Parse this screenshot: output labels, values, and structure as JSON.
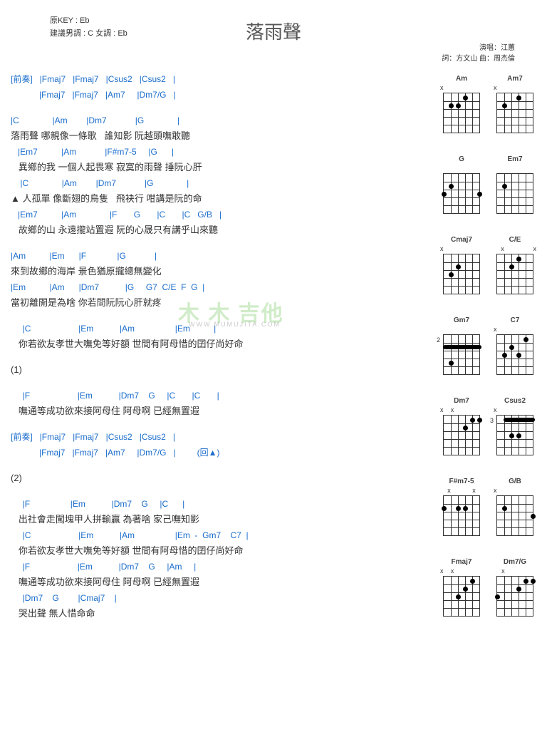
{
  "header": {
    "title": "落雨聲",
    "original_key_label": "原KEY : Eb",
    "suggested_label": "建議男調 : C 女調 : Eb",
    "singer_label": "演唱：江蕙",
    "composer_label": "詞：方文山  曲：周杰倫"
  },
  "watermark": {
    "main": "木 木 吉他",
    "sub": "WWW.MUMUJITA.COM"
  },
  "sections": [
    {
      "id": "intro1",
      "type": "intro",
      "lines": [
        {
          "chords": "[前奏]   |Fmaj7   |Fmaj7   |Csus2   |Csus2   |"
        },
        {
          "chords": "            |Fmaj7   |Fmaj7   |Am7     |Dm7/G   |"
        }
      ]
    },
    {
      "id": "v1",
      "type": "verse",
      "lines": [
        {
          "chords": "|C              |Am        |Dm7            |G              |",
          "lyric": "落雨聲 哪親像一條歌   誰知影 阮越頭嘸敢聽"
        },
        {
          "chords": "   |Em7          |Am            |F#m7-5     |G      |",
          "lyric": "   異鄉的我 一個人起畏寒 寂寞的雨聲 捶阮心肝"
        },
        {
          "chords": "    |C              |Am        |Dm7            |G              |",
          "lyric": "▲ 人孤單 像斷翅的鳥隻   飛袂行 咁講是阮的命"
        },
        {
          "chords": "   |Em7          |Am              |F       G       |C       |C   G/B   |",
          "lyric": "   故鄉的山 永遠攏站置遐 阮的心晟只有講乎山來聽"
        }
      ]
    },
    {
      "id": "ch1",
      "type": "chorus",
      "lines": [
        {
          "chords": "|Am          |Em      |F             |G            |",
          "lyric": "來到故鄉的海岸 景色猶原攏總無變化"
        },
        {
          "chords": "|Em          |Am      |Dm7           |G     G7  C/E  F  G  |",
          "lyric": "當初離開是為啥 你若問阮阮心肝就疼"
        }
      ]
    },
    {
      "id": "ch1b",
      "type": "chorus",
      "lines": [
        {
          "chords": "     |C                    |Em           |Am                 |Em          |",
          "lyric": "   你若欲友孝世大嘸免等好額 世間有阿母惜的囝仔尚好命"
        }
      ]
    },
    {
      "id": "label1",
      "type": "label",
      "lines": [
        {
          "lyric": "(1)"
        }
      ]
    },
    {
      "id": "ch1c",
      "type": "chorus",
      "lines": [
        {
          "chords": "     |F                    |Em           |Dm7    G     |C       |C       |",
          "lyric": "   嘸通等成功欲來接阿母住 阿母啊 已經無置遐"
        }
      ]
    },
    {
      "id": "intro2",
      "type": "intro",
      "lines": [
        {
          "chords": "[前奏]   |Fmaj7   |Fmaj7   |Csus2   |Csus2   |"
        },
        {
          "chords": "            |Fmaj7   |Fmaj7   |Am7     |Dm7/G   |         (回▲)"
        }
      ]
    },
    {
      "id": "label2",
      "type": "label",
      "lines": [
        {
          "lyric": "(2)"
        }
      ]
    },
    {
      "id": "v2",
      "type": "verse",
      "lines": [
        {
          "chords": "     |F                 |Em           |Dm7    G     |C      |",
          "lyric": "   出社會走闖塊甲人拼輸贏 為著啥 家己嘸知影"
        },
        {
          "chords": "     |C                    |Em           |Am                 |Em  -  Gm7    C7  |",
          "lyric": "   你若欲友孝世大嘸免等好額 世間有阿母惜的囝仔尚好命"
        },
        {
          "chords": "     |F                    |Em           |Dm7    G     |Am     |",
          "lyric": "   嘸通等成功欲來接阿母住 阿母啊 已經無置遐"
        },
        {
          "chords": "     |Dm7    G        |Cmaj7    |",
          "lyric": "   哭出聲 無人惜命命"
        }
      ]
    }
  ],
  "chord_diagrams": [
    {
      "name": "Am",
      "open": [
        "x",
        "",
        "",
        "",
        "",
        ""
      ],
      "dots": [
        {
          "s": 1,
          "f": 2
        },
        {
          "s": 2,
          "f": 2
        },
        {
          "s": 3,
          "f": 1
        }
      ]
    },
    {
      "name": "Am7",
      "open": [
        "x",
        "",
        "",
        "",
        "",
        ""
      ],
      "dots": [
        {
          "s": 1,
          "f": 2
        },
        {
          "s": 3,
          "f": 1
        }
      ]
    },
    {
      "name": "G",
      "open": [
        "",
        "",
        "",
        "",
        "",
        ""
      ],
      "dots": [
        {
          "s": 0,
          "f": 3
        },
        {
          "s": 1,
          "f": 2
        },
        {
          "s": 5,
          "f": 3
        }
      ]
    },
    {
      "name": "Em7",
      "open": [
        "",
        "",
        "",
        "",
        "",
        ""
      ],
      "dots": [
        {
          "s": 1,
          "f": 2
        }
      ]
    },
    {
      "name": "Cmaj7",
      "open": [
        "x",
        "",
        "",
        "",
        "",
        ""
      ],
      "dots": [
        {
          "s": 1,
          "f": 3
        },
        {
          "s": 2,
          "f": 2
        }
      ]
    },
    {
      "name": "C/E",
      "open": [
        "",
        "x",
        "",
        "",
        "",
        "x"
      ],
      "dots": [
        {
          "s": 2,
          "f": 2
        },
        {
          "s": 3,
          "f": 1
        }
      ]
    },
    {
      "name": "Gm7",
      "open": [
        "",
        "",
        "",
        "",
        "",
        ""
      ],
      "pos": "2",
      "barre": {
        "f": 2,
        "from": 0,
        "to": 5
      },
      "dots": [
        {
          "s": 1,
          "f": 4
        }
      ]
    },
    {
      "name": "C7",
      "open": [
        "x",
        "",
        "",
        "",
        "",
        ""
      ],
      "dots": [
        {
          "s": 1,
          "f": 3
        },
        {
          "s": 2,
          "f": 2
        },
        {
          "s": 3,
          "f": 3
        },
        {
          "s": 4,
          "f": 1
        }
      ]
    },
    {
      "name": "Dm7",
      "open": [
        "x",
        "x",
        "",
        "",
        "",
        ""
      ],
      "dots": [
        {
          "s": 3,
          "f": 2
        },
        {
          "s": 4,
          "f": 1
        },
        {
          "s": 5,
          "f": 1
        }
      ]
    },
    {
      "name": "Csus2",
      "open": [
        "x",
        "",
        "",
        "",
        "",
        ""
      ],
      "pos": "3",
      "barre": {
        "f": 1,
        "from": 1,
        "to": 5
      },
      "dots": [
        {
          "s": 2,
          "f": 3
        },
        {
          "s": 3,
          "f": 3
        }
      ]
    },
    {
      "name": "F#m7-5",
      "open": [
        "",
        "x",
        "",
        "",
        "x",
        ""
      ],
      "dots": [
        {
          "s": 0,
          "f": 2
        },
        {
          "s": 2,
          "f": 2
        },
        {
          "s": 3,
          "f": 2
        }
      ]
    },
    {
      "name": "G/B",
      "open": [
        "x",
        "",
        "",
        "",
        "",
        ""
      ],
      "dots": [
        {
          "s": 1,
          "f": 2
        },
        {
          "s": 5,
          "f": 3
        }
      ]
    },
    {
      "name": "Fmaj7",
      "open": [
        "x",
        "x",
        "",
        "",
        "",
        ""
      ],
      "dots": [
        {
          "s": 2,
          "f": 3
        },
        {
          "s": 3,
          "f": 2
        },
        {
          "s": 4,
          "f": 1
        }
      ]
    },
    {
      "name": "Dm7/G",
      "open": [
        "",
        "x",
        "",
        "",
        "",
        ""
      ],
      "dots": [
        {
          "s": 0,
          "f": 3
        },
        {
          "s": 3,
          "f": 2
        },
        {
          "s": 4,
          "f": 1
        },
        {
          "s": 5,
          "f": 1
        }
      ]
    }
  ]
}
